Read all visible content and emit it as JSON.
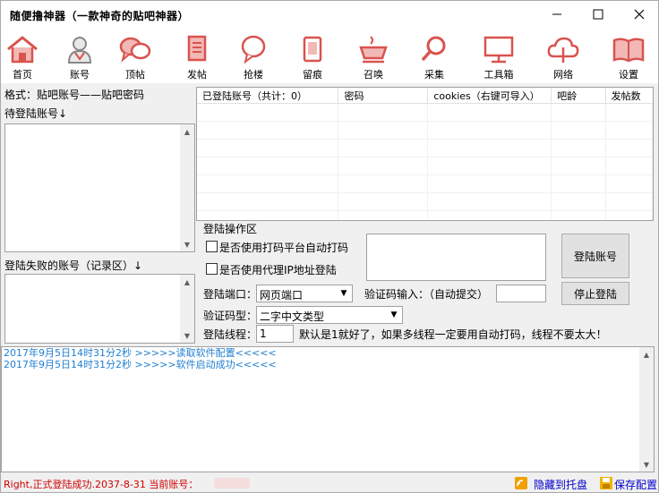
{
  "window": {
    "title": "随便撸神器（一款神奇的贴吧神器）"
  },
  "toolbar": {
    "items": [
      {
        "label": "首页",
        "icon": "home-icon"
      },
      {
        "label": "账号",
        "icon": "user-icon"
      },
      {
        "label": "顶帖",
        "icon": "chat-icon"
      },
      {
        "label": "发帖",
        "icon": "document-icon"
      },
      {
        "label": "抢楼",
        "icon": "bubble-icon"
      },
      {
        "label": "留痕",
        "icon": "tablet-icon"
      },
      {
        "label": "召唤",
        "icon": "cup-icon"
      },
      {
        "label": "采集",
        "icon": "search-icon"
      },
      {
        "label": "工具箱",
        "icon": "monitor-icon"
      },
      {
        "label": "网络",
        "icon": "cloud-icon"
      },
      {
        "label": "设置",
        "icon": "book-icon"
      }
    ],
    "icon_color": "#d9534f"
  },
  "left": {
    "format_label": "格式：贴吧账号——贴吧密码",
    "pending_label": "待登陆账号↓",
    "failed_label": "登陆失败的账号（记录区）↓"
  },
  "accounts_table": {
    "columns": [
      "已登陆账号（共计：0）",
      "密码",
      "cookies（右键可导入）",
      "吧龄",
      "发帖数"
    ]
  },
  "login_group": {
    "title": "登陆操作区",
    "captcha_checkbox": "是否使用打码平台自动打码",
    "proxy_checkbox": "是否使用代理IP地址登陆",
    "port_label": "登陆端口：",
    "port_value": "网页端口",
    "captcha_input_label": "验证码输入：（自动提交）",
    "captcha_type_label": "验证码型：",
    "captcha_type_value": "二字中文类型",
    "threads_label": "登陆线程：",
    "threads_value": "1",
    "threads_hint": "默认是1就好了，如果多线程一定要用自动打码，线程不要太大！",
    "login_button": "登陆账号",
    "stop_button": "停止登陆"
  },
  "log": {
    "lines": [
      "2017年9月5日14时31分2秒 >>>>>读取软件配置<<<<<",
      "2017年9月5日14时31分2秒 >>>>>软件启动成功<<<<<"
    ],
    "color": "#1f7fd0"
  },
  "status": {
    "text": "Right,正式登陆成功.2037-8-31 当前账号：",
    "text_color": "#d00000",
    "hide_tray": "隐藏到托盘",
    "save_config": "保存配置",
    "link_color": "#0000cc"
  }
}
